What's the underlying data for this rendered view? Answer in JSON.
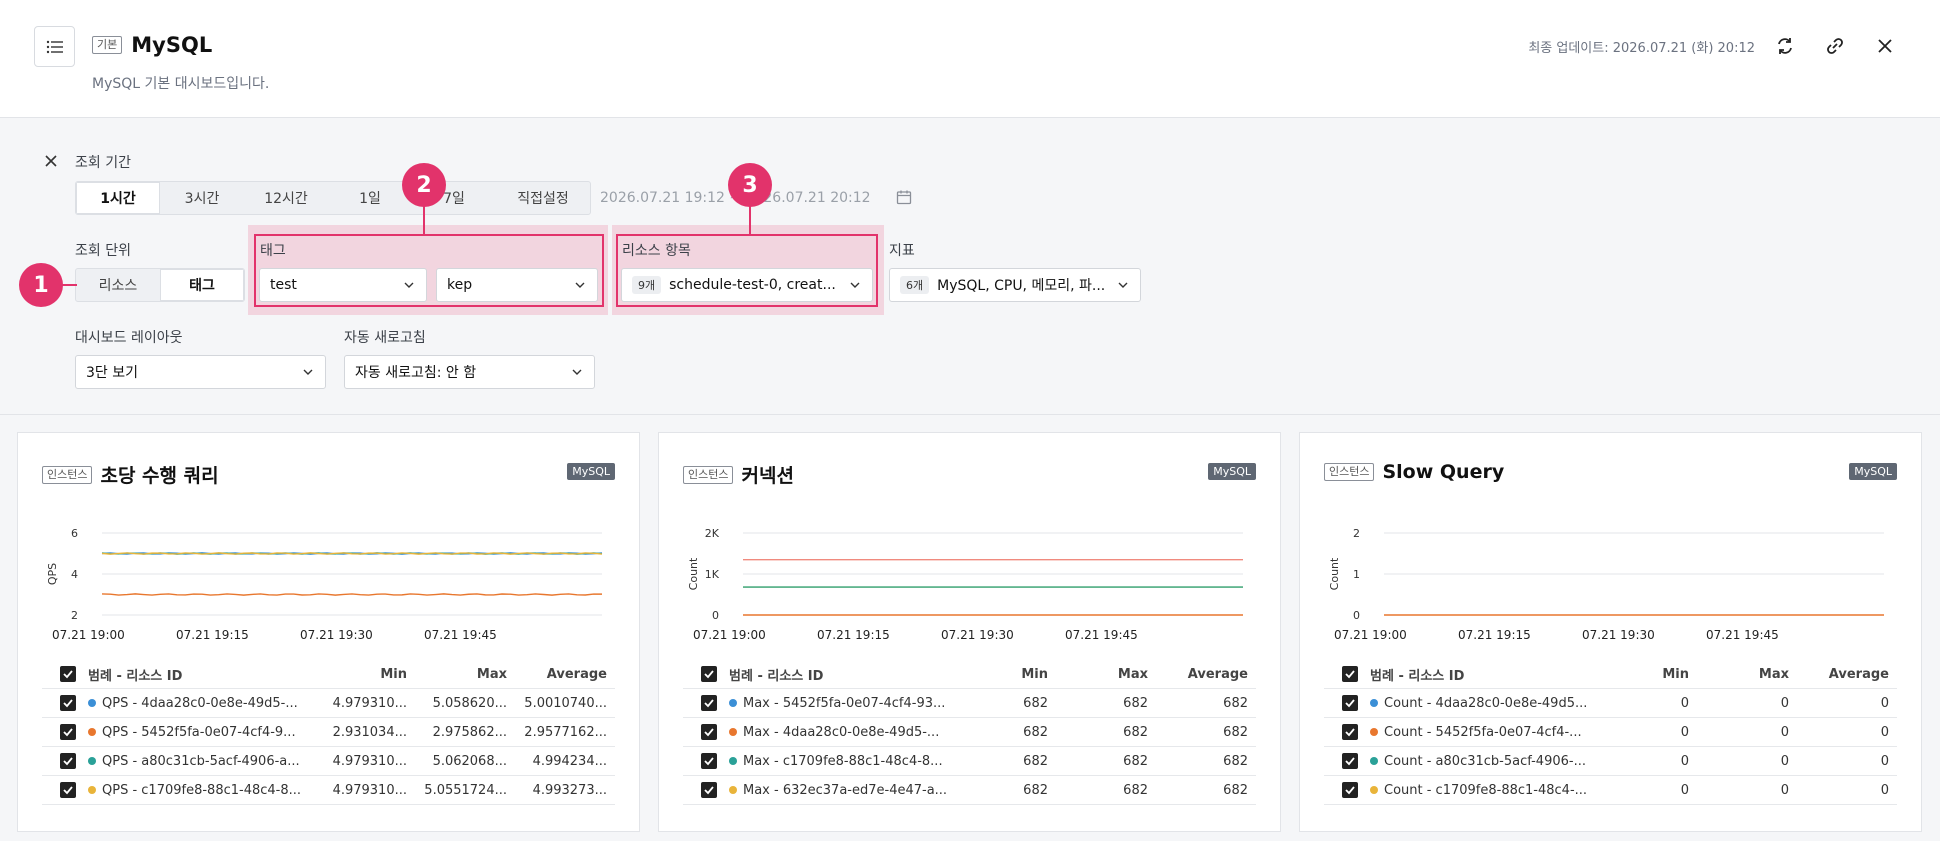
{
  "header": {
    "tag": "기본",
    "title": "MySQL",
    "subtitle": "MySQL 기본 대시보드입니다.",
    "updated": "최종 업데이트: 2026.07.21 (화) 20:12"
  },
  "filters": {
    "period_label": "조회 기간",
    "period_tabs": [
      "1시간",
      "3시간",
      "12시간",
      "1일",
      "7일",
      "직접설정"
    ],
    "period_active": "1시간",
    "range_text": "2026.07.21 19:12 ~ 2026.07.21 20:12",
    "unit_label": "조회 단위",
    "unit_tabs": [
      "리소스",
      "태그"
    ],
    "unit_active": "태그",
    "tag_label": "태그",
    "tag_key": "test",
    "tag_value": "kep",
    "resource_label": "리소스 항목",
    "resource_count": "9개",
    "resource_value": "schedule-test-0, creat...",
    "metric_label": "지표",
    "metric_count": "6개",
    "metric_value": "MySQL, CPU, 메모리, 파...",
    "layout_label": "대시보드 레이아웃",
    "layout_value": "3단 보기",
    "refresh_label": "자동 새로고침",
    "refresh_value": "자동 새로고침: 안 함"
  },
  "callouts": [
    "1",
    "2",
    "3"
  ],
  "colors": {
    "accent": "#e2336b",
    "blue": "#3b8fd6",
    "orange": "#e8772e",
    "teal": "#2aa198",
    "yellow": "#e9b43a"
  },
  "cards": [
    {
      "badge": "인스턴스",
      "title": "초당 수행 쿼리",
      "db": "MySQL",
      "legend_header": [
        "범례 - 리소스 ID",
        "Min",
        "Max",
        "Average"
      ],
      "rows": [
        {
          "name": "QPS - 4daa28c0-0e8e-49d5-...",
          "min": "4.979310...",
          "max": "5.058620...",
          "avg": "5.0010740...",
          "color": "#3b8fd6"
        },
        {
          "name": "QPS - 5452f5fa-0e07-4cf4-9...",
          "min": "2.931034...",
          "max": "2.975862...",
          "avg": "2.9577162...",
          "color": "#e8772e"
        },
        {
          "name": "QPS - a80c31cb-5acf-4906-a...",
          "min": "4.979310...",
          "max": "5.062068...",
          "avg": "4.994234...",
          "color": "#2aa198"
        },
        {
          "name": "QPS - c1709fe8-88c1-48c4-8...",
          "min": "4.979310...",
          "max": "5.0551724...",
          "avg": "4.993273...",
          "color": "#e9b43a"
        }
      ]
    },
    {
      "badge": "인스턴스",
      "title": "커넥션",
      "db": "MySQL",
      "legend_header": [
        "범례 - 리소스 ID",
        "Min",
        "Max",
        "Average"
      ],
      "rows": [
        {
          "name": "Max - 5452f5fa-0e07-4cf4-93...",
          "min": "682",
          "max": "682",
          "avg": "682",
          "color": "#3b8fd6"
        },
        {
          "name": "Max - 4daa28c0-0e8e-49d5-...",
          "min": "682",
          "max": "682",
          "avg": "682",
          "color": "#e8772e"
        },
        {
          "name": "Max - c1709fe8-88c1-48c4-8...",
          "min": "682",
          "max": "682",
          "avg": "682",
          "color": "#2aa198"
        },
        {
          "name": "Max - 632ec37a-ed7e-4e47-a...",
          "min": "682",
          "max": "682",
          "avg": "682",
          "color": "#e9b43a"
        }
      ]
    },
    {
      "badge": "인스턴스",
      "title": "Slow Query",
      "db": "MySQL",
      "legend_header": [
        "범례 - 리소스 ID",
        "Min",
        "Max",
        "Average"
      ],
      "rows": [
        {
          "name": "Count - 4daa28c0-0e8e-49d5...",
          "min": "0",
          "max": "0",
          "avg": "0",
          "color": "#3b8fd6"
        },
        {
          "name": "Count - 5452f5fa-0e07-4cf4-...",
          "min": "0",
          "max": "0",
          "avg": "0",
          "color": "#e8772e"
        },
        {
          "name": "Count - a80c31cb-5acf-4906-...",
          "min": "0",
          "max": "0",
          "avg": "0",
          "color": "#2aa198"
        },
        {
          "name": "Count - c1709fe8-88c1-48c4-...",
          "min": "0",
          "max": "0",
          "avg": "0",
          "color": "#e9b43a"
        }
      ]
    }
  ],
  "chart_data": [
    {
      "type": "line",
      "ylabel": "QPS",
      "ylim": [
        2,
        6
      ],
      "yticks": [
        "2",
        "4",
        "6"
      ],
      "xticks": [
        "07.21 19:00",
        "07.21 19:15",
        "07.21 19:30",
        "07.21 19:45"
      ],
      "series": [
        {
          "values": [
            5.0,
            5.0
          ],
          "color": "#3b8fd6"
        },
        {
          "values": [
            3.0,
            3.0
          ],
          "color": "#e8772e"
        },
        {
          "values": [
            5.0,
            5.0
          ],
          "color": "#2aa198"
        },
        {
          "values": [
            5.0,
            5.0
          ],
          "color": "#e9b43a"
        }
      ]
    },
    {
      "type": "line",
      "ylabel": "Count",
      "ylim": [
        0,
        2000
      ],
      "yticks": [
        "0",
        "1K",
        "2K"
      ],
      "xticks": [
        "07.21 19:00",
        "07.21 19:15",
        "07.21 19:30",
        "07.21 19:45"
      ],
      "series": [
        {
          "values": [
            1350,
            1350
          ],
          "color": "#f08a7e"
        },
        {
          "values": [
            682,
            682
          ],
          "color": "#2e9e6a"
        },
        {
          "values": [
            0,
            0
          ],
          "color": "#e8772e"
        }
      ]
    },
    {
      "type": "line",
      "ylabel": "Count",
      "ylim": [
        0,
        2
      ],
      "yticks": [
        "0",
        "1",
        "2"
      ],
      "xticks": [
        "07.21 19:00",
        "07.21 19:15",
        "07.21 19:30",
        "07.21 19:45"
      ],
      "series": [
        {
          "values": [
            0,
            0
          ],
          "color": "#e8772e"
        }
      ]
    }
  ]
}
